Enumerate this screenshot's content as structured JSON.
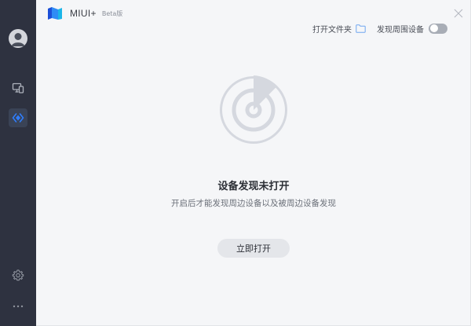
{
  "app": {
    "title": "MIUI+",
    "badge": "Beta版"
  },
  "toolbar": {
    "open_folder_label": "打开文件夹",
    "discover_label": "发现周围设备",
    "discover_enabled": false
  },
  "status": {
    "title": "设备发现未打开",
    "description": "开启后才能发现周边设备以及被周边设备发现",
    "open_button_label": "立即打开"
  },
  "sidebar": {
    "active_item": "share"
  },
  "colors": {
    "sidebar_bg": "#2e3240",
    "accent": "#2f7dfb",
    "background": "#f5f6f8"
  }
}
